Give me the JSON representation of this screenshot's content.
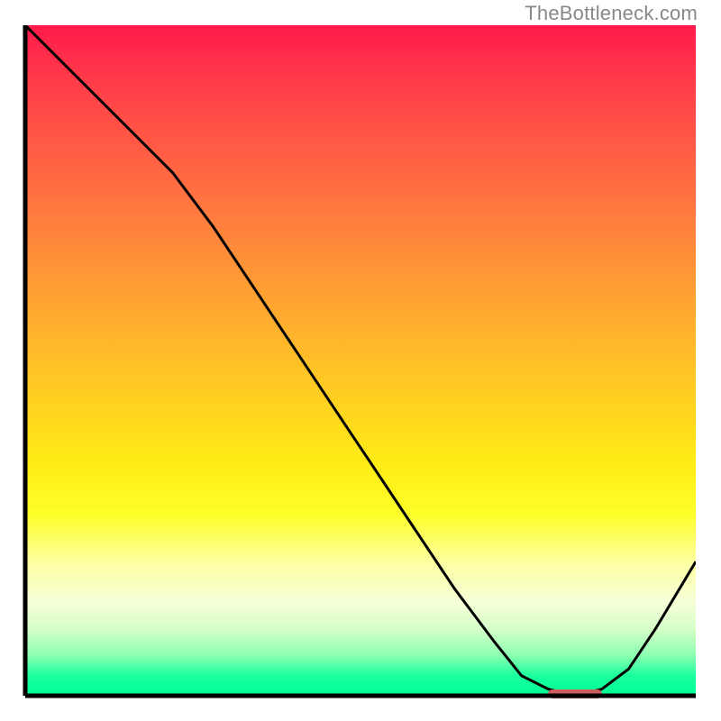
{
  "watermark": "TheBottleneck.com",
  "colors": {
    "axis": "#000000",
    "curve": "#000000",
    "marker": "#cd5c5c",
    "gradient_top": "#ff1a4a",
    "gradient_bottom": "#00ff94"
  },
  "chart_data": {
    "type": "line",
    "title": "",
    "xlabel": "",
    "ylabel": "",
    "xlim": [
      0,
      100
    ],
    "ylim": [
      0,
      100
    ],
    "grid": false,
    "legend": false,
    "x": [
      0,
      4,
      10,
      16,
      22,
      28,
      34,
      40,
      46,
      52,
      58,
      64,
      70,
      74,
      78,
      82,
      86,
      90,
      94,
      100
    ],
    "y": [
      100,
      96,
      90,
      84,
      78,
      70,
      61,
      52,
      43,
      34,
      25,
      16,
      8,
      3,
      1,
      0,
      1,
      4,
      10,
      20
    ],
    "annotations": [
      {
        "kind": "marker",
        "x_start": 78,
        "x_end": 86,
        "y": 0
      }
    ]
  }
}
